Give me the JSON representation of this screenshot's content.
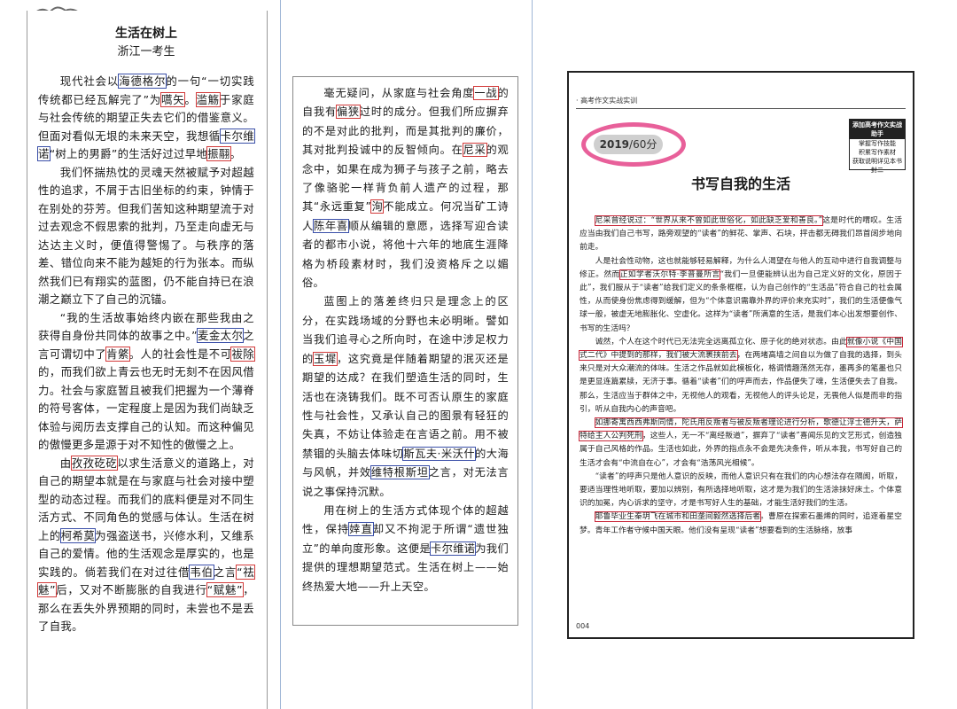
{
  "col1": {
    "title": "生活在树上",
    "author": "浙江一考生",
    "p1": [
      "现代社会以",
      "海德格尔",
      "的一句“一切实践传统都已经瓦解完了”为",
      "嚆矢",
      "。",
      "滥觞",
      "于家庭与社会传统的期望正失去它们的借鉴意义。但面对看似无垠的未来天空，我想循",
      "卡尔维诺",
      "“树上的男爵”的生活好过过早地",
      "振翮",
      "。"
    ],
    "p2": "我们怀揣热忱的灵魂天然被赋予对超越性的追求，不屑于古旧坐标的约束，钟情于在别处的芬芳。但我们苦知这种期望流于对过去观念不假思索的批判，乃至走向虚无与达达主义时，便值得警惕了。与秩序的落差、错位向来不能为越矩的行为张本。而纵然我们已有翔实的蓝图，仍不能自持已在浪潮之巅立下了自己的沉锚。",
    "p3": [
      "“我的生活故事始终内嵌在那些我由之获得自身份共同体的故事之中。”",
      "麦金太尔",
      "之言可谓切中了",
      "肯綮",
      "。人的社会性是不可",
      "祓除",
      "的，而我们欲上青云也无时无刻不在因风借力。社会与家庭暂且被我们把握为一个薄脊的符号客体，一定程度上是因为我们尚缺乏体验与阅历去支撑自己的认知。而这种偏见的傲慢更多是源于对不知性的傲慢之上。"
    ],
    "p4": [
      "由",
      "孜孜矻矻",
      "以求生活意义的道路上，对自己的期望本就是在与家庭与社会对接中塑型的动态过程。而我们的底料便是对不同生活方式、不同角色的觉感与体认。生活在树上的",
      "柯希莫",
      "为强盗送书，兴修水利，又维系自己的爱情。他的生活观念是厚实的，也是实践的。倘若我们在对过往借",
      "韦伯",
      "之言",
      "“祛魅”",
      "后，又对不断膨胀的自我进行",
      "“赋魅”",
      "，那么在丢失外界预期的同时，未尝也不是丢了自我。"
    ]
  },
  "col2": {
    "p1": [
      "毫无疑问，从家庭与社会角度",
      "一战",
      "的自我有",
      "偏狭",
      "过时的成分。但我们所应摒弃的不是对此的批判，而是其批判的廉价，其对批判投诚中的反智倾向。在",
      "尼采",
      "的观念中，如果在成为狮子与孩子之前，略去了像骆驼一样背负前人遗产的过程，那其“永远重复”",
      "洵",
      "不能成立。何况当矿工诗人",
      "陈年喜",
      "顺从编辑的意愿，选择写迎合读者的都市小说，将他十六年的地底生涯降格为桥段素材时，我们没资格斥之以媚俗。"
    ],
    "p2": [
      "蓝图上的落差终归只是理念上的区分，在实践场域的分野也未必明晰。譬如当我们追寻心之所向时，在途中涉足权力的",
      "玉墀",
      "，这究竟是伴随着期望的泯灭还是期望的达成？在我们塑造生活的同时，生活也在浇铸我们。既不可否认原生的家庭性与社会性，又承认自己的图景有轻狂的失真，不妨让体验走在言语之前。用不被禁锢的头脑去体味切",
      "斯瓦夫·米沃什",
      "的大海与风帆，并效",
      "维特根斯坦",
      "之言，对无法言说之事保持沉默。"
    ],
    "p3": [
      "用在树上的生活方式体现个体的超越性，保持",
      "婞直",
      "却又不拘泥于所谓“遗世独立”的单向度形象。这便是",
      "卡尔维诺",
      "为我们提供的理想期望范式。生活在树上——始终热爱大地——升上天空。"
    ]
  },
  "book": {
    "header": "· 高考作文实战实训",
    "badge_year": "2019",
    "badge_score": "/60分",
    "side_box_title": "添加高考作文实战助手",
    "side_box_lines": [
      "掌握写作技能",
      "积累写作素材",
      "获取说明详见本书封二"
    ],
    "title": "书写自我的生活",
    "paragraphs": [
      [
        "",
        "尼采曾经说过：“世界从来不曾如此世俗化，如此缺乏爱和善良。”",
        "这是时代的喟叹。生活应当由我们自己书写，路旁观望的“读者”的鲜花、掌声、石块，抨击都无碍我们昂首阔步地向前走。"
      ],
      [
        "人是社会性动物，这也就能够轻易解释，为什么人渴望在与他人的互动中进行自我调整与修正。然而",
        "正如学者沃尔特·李普曼所言",
        "“我们一旦便能辨认出为自己定义好的文化，原因于此”，我们服从于“读者”给我们定义的条条框框，认为自己创作的“生活品”符合自己的社会属性，从而使身份焦虑得到缓解，但为“个体意识需靠外界的评价来充实时”，我们的生活便像气球一般，被虚无地膨胀化、空虚化。这样为“读者”所满意的生活，是我们本心出发想要创作、书写的生活吗？"
      ],
      [
        "诚然，个人在这个时代已无法完全远离孤立化、原子化的绝对状态。由此",
        "就像小说《中国式二代》中提到的那样，我们被大流裹挟前去",
        "，在两堵高墙之间自以为做了自我的选择，到头来只是对大众潮流的体味。生活之作品就如此模板化，格调情趣荡然无存，墨再多的笔墨也只是更显连篇累牍，无济于事。循着“读者”们的呼声而去，作品便失了魂，生活便失去了自我。那么，生活应当于群体之中，无视他人的观看，无视他人的评头论足，无畏他人似是而非的指引，听从自我内心的声音吧。"
      ],
      [
        "",
        "如挪寄寓西西弗斯同情，陀氏用反叛者与被反叛者理论进行分析，歌德让浮士德升天，萨特给主人公判死刑",
        "，这些人，无一不“离经叛道”，摒弃了“读者”喜闻乐见的文艺形式，创造独属于自己风格的作品。生活也如此，外界的指点永不会是先决条件，听从本我，书写好自己的生活才会有“中流自在心”，才会有“浩荡风光相候”。"
      ],
      [
        "“读者”的呼声只是他人意识的反映，而他人意识只有在我们的内心想法存在隔阂，听取，要适当理性地听取，要加以辨别，有所选择地听取，这才是为我们的生活涂抹好床土。个体意识的加冕，内心诉求的坚守，才是书写好人生的基础，才能生活好我们的生活。"
      ],
      [
        "",
        "耶鲁毕业生秦玥飞在城市和田垄间毅然选择后者",
        "。曹原在探索石墨烯的同时，追逐着星空梦。青年工作者守候中国天眼。他们没有呈现“读者”想要看到的生活脉络，放事"
      ]
    ],
    "page_number": "004"
  },
  "colors": {
    "red_box": "#d23a3a",
    "blue_box": "#3a4fa8",
    "badge_ring": "#e8609a"
  }
}
